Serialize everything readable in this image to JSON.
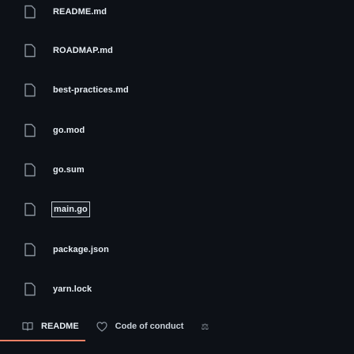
{
  "files": [
    {
      "name": "README.md",
      "icon": "file-icon"
    },
    {
      "name": "ROADMAP.md",
      "icon": "file-icon"
    },
    {
      "name": "best-practices.md",
      "icon": "file-icon"
    },
    {
      "name": "go.mod",
      "icon": "file-icon"
    },
    {
      "name": "go.sum",
      "icon": "file-icon"
    },
    {
      "name": "main.go",
      "icon": "file-icon"
    },
    {
      "name": "package.json",
      "icon": "file-icon"
    },
    {
      "name": "yarn.lock",
      "icon": "file-icon"
    }
  ],
  "tabs": {
    "readme_label": "README",
    "coc_label": "Code of conduct",
    "more_label": "⚖"
  },
  "colors": {
    "background": "#0d1117",
    "text": "#e6edf3",
    "muted": "#8b949e",
    "accent": "#f78166"
  }
}
